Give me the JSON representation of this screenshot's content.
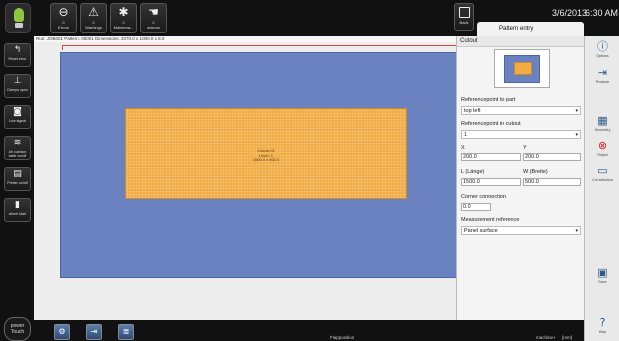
{
  "topbar": {
    "buttons": [
      {
        "icon": "clock-icon",
        "count": "0",
        "label": "Errors"
      },
      {
        "icon": "warning-icon",
        "count": "0",
        "label": "Warnings"
      },
      {
        "icon": "wrench-icon",
        "count": "0",
        "label": "Maintena..."
      },
      {
        "icon": "hand-icon",
        "count": "0",
        "label": "actions"
      }
    ],
    "back_label": "Back",
    "date": "3/6/2013",
    "time": "6:30 AM",
    "tab_label": "Pattern entry"
  },
  "sidebar": {
    "items": [
      {
        "icon": "reset-icon",
        "label": "Reset error"
      },
      {
        "icon": "clamps-icon",
        "label": "Clamps open"
      },
      {
        "icon": "signal-icon",
        "label": "Low signal"
      },
      {
        "icon": "air-cushion-icon",
        "label": "Air cushion table on/off"
      },
      {
        "icon": "printer-icon",
        "label": "Printer on/off"
      },
      {
        "icon": "wheel-start-icon",
        "label": "wheel start"
      }
    ],
    "brand": "power Touch"
  },
  "main": {
    "run_info": "Run: JOB001  Pattern: 00001  Dimensions: 2070.0 x 1000.0 x 8.0",
    "cutout_text": [
      "Cutout 01",
      "Level: 1",
      "1500.0 x 500.0"
    ]
  },
  "panel": {
    "title": "Cutout",
    "ref_part_label": "Referencepoint to part",
    "ref_part_value": "top left",
    "ref_cutout_label": "Referencepoint in cutout",
    "ref_cutout_value": "1",
    "x_label": "X",
    "x_value": "200.0",
    "y_label": "Y",
    "y_value": "200.0",
    "l_label": "L (Länge)",
    "l_value": "1500.0",
    "w_label": "W (Breite)",
    "w_value": "500.0",
    "corner_label": "Corner connection",
    "corner_value": "0.0",
    "measure_label": "Measurement reference",
    "measure_value": "Panel surface"
  },
  "tools": {
    "items": [
      {
        "icon": "info-icon",
        "label": "Options"
      },
      {
        "icon": "produce-icon",
        "label": "Produce"
      },
      {
        "icon": "geometry-icon",
        "label": "Geometry"
      },
      {
        "icon": "reject-icon",
        "label": "Reject"
      },
      {
        "icon": "cut-selection-icon",
        "label": "Cut selection"
      },
      {
        "icon": "save-icon",
        "label": "Save"
      },
      {
        "icon": "help-icon",
        "label": "Help"
      }
    ]
  },
  "bottom": {
    "status_position": "Flapposition",
    "status_machine": "machine+",
    "status_unit": "[mm]"
  },
  "colors": {
    "plate": "#6b82c1",
    "cutout": "#f0ac45",
    "accent_green": "#8ec63f",
    "reject_red": "#c8202a"
  }
}
